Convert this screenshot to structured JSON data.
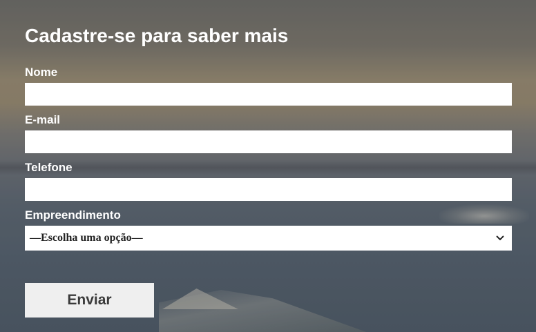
{
  "form": {
    "title": "Cadastre-se para saber mais",
    "fields": {
      "name_label": "Nome",
      "email_label": "E-mail",
      "phone_label": "Telefone",
      "development_label": "Empreendimento",
      "development_value": "—Escolha uma opção—"
    },
    "submit_label": "Enviar"
  },
  "colors": {
    "text": "#ffffff",
    "field_bg": "#ffffff",
    "button_bg": "#efefef",
    "button_text": "#3a3a3a"
  }
}
